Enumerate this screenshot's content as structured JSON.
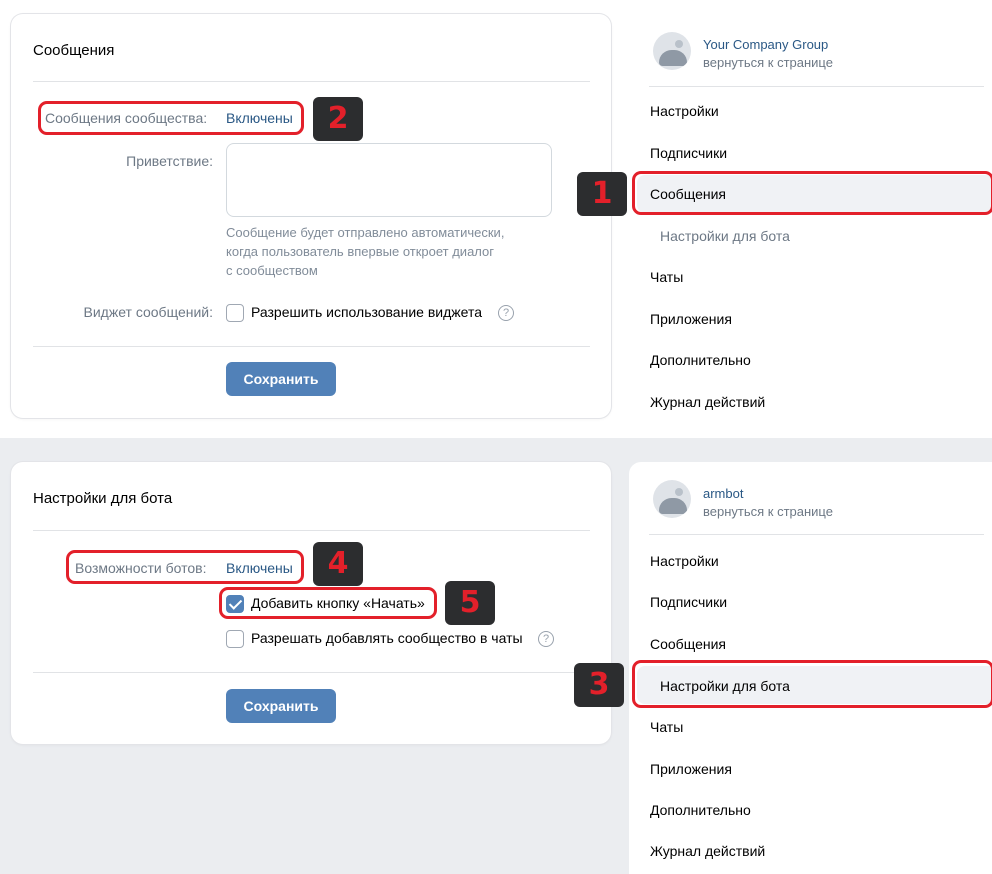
{
  "messages_card": {
    "title": "Сообщения",
    "community_messages_label": "Сообщения сообщества:",
    "community_messages_value": "Включены",
    "greeting_label": "Приветствие:",
    "greeting_value": "",
    "greeting_hint": [
      "Сообщение будет отправлено автоматически,",
      "когда пользователь впервые откроет диалог",
      "с сообществом"
    ],
    "widget_label": "Виджет сообщений:",
    "widget_checkbox_label": "Разрешить использование виджета",
    "widget_checked": false,
    "help_glyph": "?",
    "save_label": "Сохранить"
  },
  "bot_card": {
    "title": "Настройки для бота",
    "bot_capabilities_label": "Возможности ботов:",
    "bot_capabilities_value": "Включены",
    "start_button_label": "Добавить кнопку «Начать»",
    "start_button_checked": true,
    "allow_chats_label": "Разрешать добавлять сообщество в чаты",
    "allow_chats_checked": false,
    "help_glyph": "?",
    "save_label": "Сохранить"
  },
  "nav_top": {
    "group_name": "Your Company Group",
    "back_link": "вернуться к странице",
    "items": [
      "Настройки",
      "Подписчики",
      "Сообщения",
      "Настройки для бота",
      "Чаты",
      "Приложения",
      "Дополнительно",
      "Журнал действий"
    ],
    "active_item": "Сообщения"
  },
  "nav_bottom": {
    "group_name": "armbot",
    "back_link": "вернуться к странице",
    "items": [
      "Настройки",
      "Подписчики",
      "Сообщения",
      "Настройки для бота",
      "Чаты",
      "Приложения",
      "Дополнительно",
      "Журнал действий"
    ],
    "active_item": "Настройки для бота"
  },
  "badges": [
    "1",
    "2",
    "3",
    "4",
    "5"
  ],
  "colors": {
    "accent": "#5181b8",
    "link": "#2a5885",
    "highlight": "#e3202a",
    "badge_bg": "#2c2d2f",
    "page_bg": "#ebedf0"
  }
}
